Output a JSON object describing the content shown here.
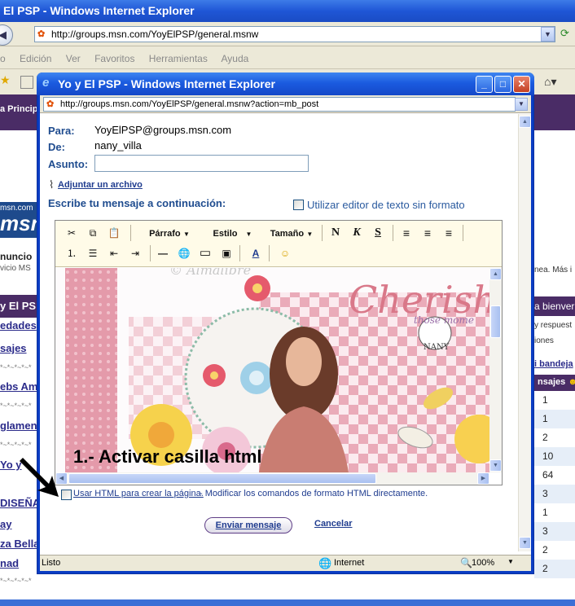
{
  "background_window": {
    "title": "El PSP - Windows Internet Explorer",
    "address": "http://groups.msn.com/YoyElPSP/general.msnw",
    "menu": [
      "o",
      "Edición",
      "Ver",
      "Favoritos",
      "Herramientas",
      "Ayuda"
    ],
    "page": {
      "header_text": "a Princip",
      "msn_small": "msn.com",
      "msn_logo": "msn",
      "announce_title": "nuncio",
      "announce_sub": "vicio MS",
      "group_title": "y El PSP",
      "left_links": [
        "edades",
        "sajes",
        "ebs Ami",
        "glamen",
        "Yo y",
        "DISEÑA",
        "ay",
        "za Bella",
        "nad"
      ],
      "left_stars": "*~*~*~*~*",
      "right_top": "nea. Más i",
      "right_bar": "a bienver",
      "right_a": "y respuest",
      "right_b": "iones",
      "right_link": "i bandeja",
      "right_head": "nsajes",
      "counts": [
        "1",
        "1",
        "2",
        "10",
        "64",
        "3",
        "1",
        "3",
        "2",
        "2"
      ]
    }
  },
  "popup": {
    "title": "Yo y El PSP - Windows Internet Explorer",
    "address": "http://groups.msn.com/YoyElPSP/general.msnw?action=mb_post",
    "form": {
      "to_label": "Para:",
      "to_value": "YoyElPSP@groups.msn.com",
      "from_label": "De:",
      "from_value": "nany_villa",
      "subject_label": "Asunto:",
      "subject_value": "",
      "attach_label": "Adjuntar un archivo",
      "write_label": "Escribe tu mensaje a continuación:",
      "plain_editor_label": "Utilizar editor de texto sin formato"
    },
    "toolbar": {
      "paragraph": "Párrafo",
      "style": "Estilo",
      "size": "Tamaño",
      "bold": "N",
      "italic": "K",
      "underline": "S"
    },
    "image_text": {
      "script_top": "Cherish",
      "script_sub": "those mome",
      "watermark": "© Almalibre",
      "tag": "NANY"
    },
    "annotation": "1.- Activar casilla html",
    "html_checkbox_link": "Usar HTML para crear la página.",
    "html_checkbox_desc": "- Modificar los comandos de formato HTML directamente.",
    "send_button": "Enviar mensaje",
    "cancel_link": "Cancelar",
    "status": {
      "text": "Listo",
      "zone": "Internet",
      "zoom": "100%"
    }
  }
}
